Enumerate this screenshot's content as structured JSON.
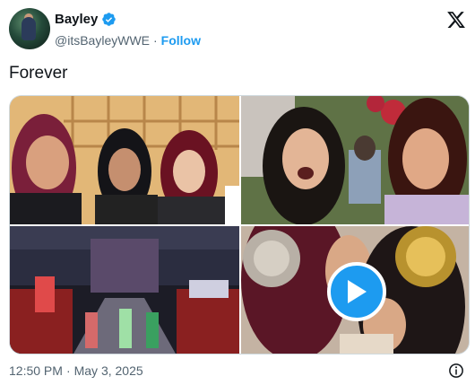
{
  "author": {
    "display_name": "Bayley",
    "handle": "@itsBayleyWWE",
    "separator": "·",
    "follow_label": "Follow"
  },
  "tweet": {
    "text": "Forever"
  },
  "timestamp": {
    "time": "12:50 PM",
    "separator": "·",
    "date": "May 3, 2025"
  },
  "icons": {
    "verified": "verified-badge-icon",
    "platform": "x-logo-icon",
    "play": "play-icon",
    "info": "info-icon"
  },
  "colors": {
    "accent": "#1d9bf0",
    "text": "#0f1419",
    "muted": "#536471"
  }
}
